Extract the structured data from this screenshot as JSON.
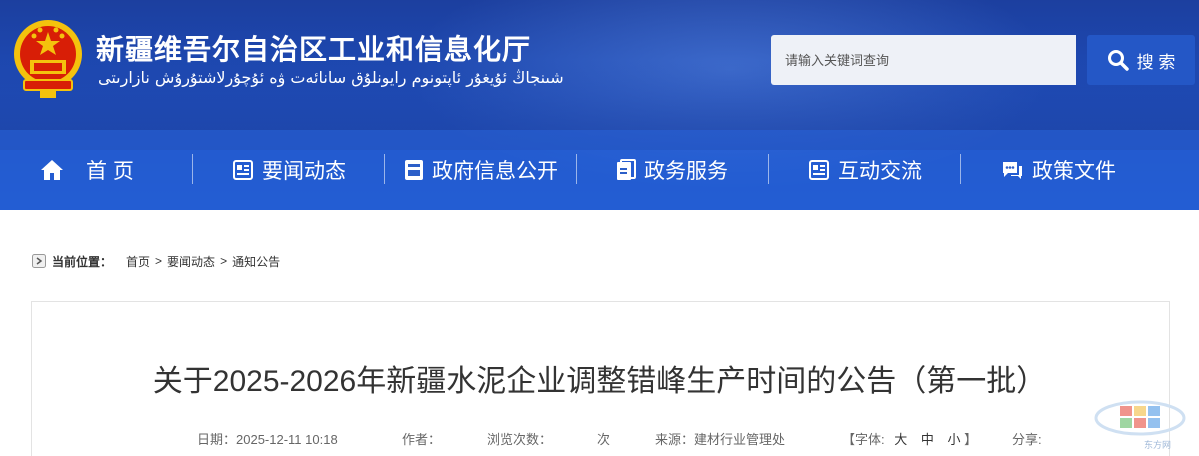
{
  "header": {
    "title": "新疆维吾尔自治区工业和信息化厅",
    "subtitle": "شىنجاڭ ئۇيغۇر ئاپتونوم رايونلۇق سانائەت ۋە ئۇچۇرلاشتۇرۇش نازارىتى",
    "search": {
      "placeholder": "请输入关键词查询",
      "button_label": "搜 索"
    }
  },
  "nav": {
    "items": [
      {
        "label": "首 页",
        "icon": "home-icon"
      },
      {
        "label": "要闻动态",
        "icon": "news-icon"
      },
      {
        "label": "政府信息公开",
        "icon": "folder-icon"
      },
      {
        "label": "政务服务",
        "icon": "service-icon"
      },
      {
        "label": "互动交流",
        "icon": "chat-doc-icon"
      },
      {
        "label": "政策文件",
        "icon": "policy-icon"
      }
    ]
  },
  "breadcrumb": {
    "label": "当前位置：",
    "items": [
      "首页",
      "要闻动态",
      "通知公告"
    ],
    "separator": ">"
  },
  "article": {
    "title": "关于2025-2026年新疆水泥企业调整错峰生产时间的公告（第一批）",
    "meta": {
      "date": "日期：2025-12-11 10:18",
      "author_label": "作者：",
      "views_label": "浏览次数：",
      "views_unit": "次",
      "source": "来源：建材行业管理处",
      "font_label_open": "【字体:",
      "font_large": "大",
      "font_medium": "中",
      "font_small": "小",
      "font_label_close": "】",
      "share_label": "分享:"
    }
  },
  "watermark": {
    "text": "东方网"
  },
  "colors": {
    "header_blue": "#1e4cb8",
    "nav_blue": "#2c6ad8",
    "emblem_red": "#d81e06",
    "emblem_gold": "#f4c20d"
  }
}
